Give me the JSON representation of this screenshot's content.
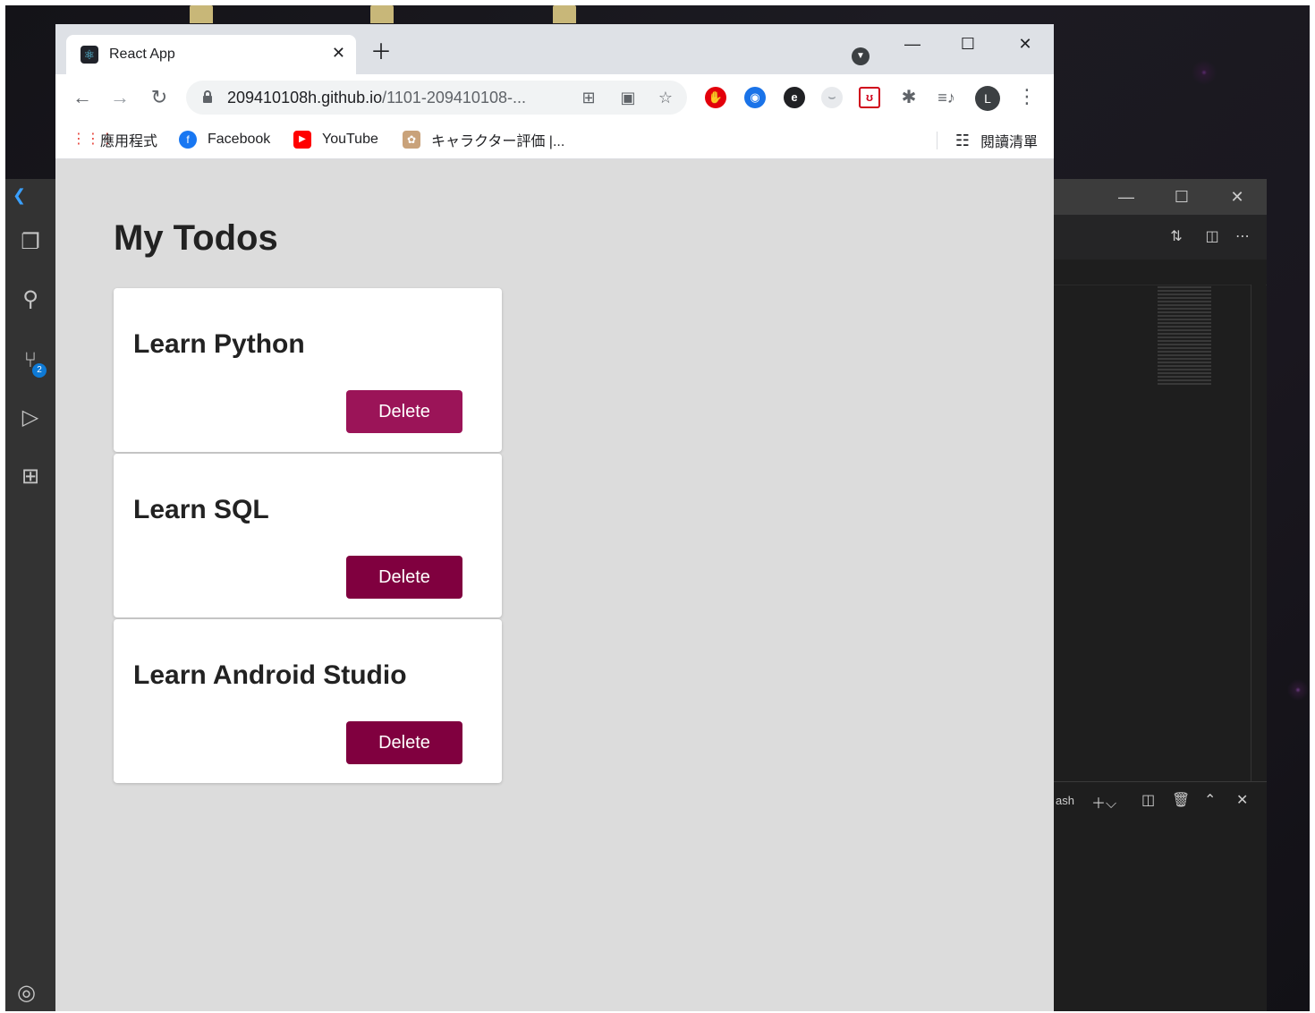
{
  "browser": {
    "tab_title": "React App",
    "url_host": "209410108h.github.io",
    "url_path": "/1101-209410108-...",
    "avatar_letter": "L",
    "icons": [
      "react-favicon",
      "close-icon",
      "plus-icon",
      "profile-dropdown-icon",
      "minimize-icon",
      "maximize-icon",
      "close-window-icon",
      "back-arrow-icon",
      "forward-arrow-icon",
      "reload-icon",
      "lock-icon",
      "qr-code-icon",
      "translate-icon",
      "star-icon",
      "extensions-icon",
      "media-control-icon",
      "menu-dots-icon"
    ],
    "bookmarks": [
      {
        "label": "應用程式"
      },
      {
        "label": "Facebook"
      },
      {
        "label": "YouTube"
      },
      {
        "label": "キャラクター評価 |..."
      }
    ],
    "reading_list": "閱讀清單"
  },
  "page": {
    "title": "My Todos",
    "todos": [
      {
        "text": "Learn Python",
        "button": "Delete"
      },
      {
        "text": "Learn SQL",
        "button": "Delete"
      },
      {
        "text": "Learn Android Studio",
        "button": "Delete"
      }
    ]
  },
  "vscode": {
    "terminal_label": "ash",
    "source_control_badge": "2"
  },
  "colors": {
    "delete_hover": "#9b1458",
    "delete": "#80003f",
    "page_bg": "#dcdcdc",
    "vscode_activity_bar": "#333333"
  }
}
